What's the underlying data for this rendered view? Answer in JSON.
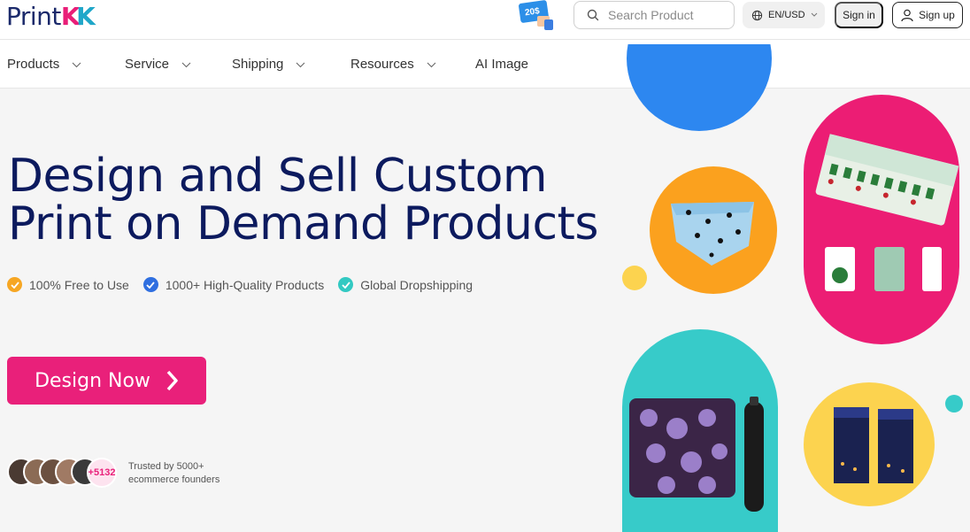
{
  "brand": {
    "logo_main": "Print",
    "logo_k1": "K",
    "logo_k2": "K"
  },
  "header": {
    "coupon_text": "20$",
    "search_placeholder": "Search Product",
    "language": "EN/USD",
    "signin_label": "Sign in",
    "signup_label": "Sign up"
  },
  "nav": {
    "items": [
      {
        "label": "Products"
      },
      {
        "label": "Service"
      },
      {
        "label": "Shipping"
      },
      {
        "label": "Resources"
      },
      {
        "label": "AI Image"
      }
    ]
  },
  "hero": {
    "title_line1": "Design and Sell Custom",
    "title_line2": "Print on Demand Products",
    "features": [
      {
        "text": "100% Free to Use",
        "color": "#f6a623"
      },
      {
        "text": "1000+ High-Quality Products",
        "color": "#2f6fe0"
      },
      {
        "text": "Global Dropshipping",
        "color": "#32c9c2"
      }
    ],
    "cta_label": "Design Now",
    "social_count": "+5132",
    "trusted_line1": "Trusted by 5000+",
    "trusted_line2": "ecommerce founders"
  },
  "colors": {
    "navy": "#0c1a5e",
    "pink": "#e9207a",
    "blue": "#2d87f0",
    "orange": "#fba11e",
    "teal": "#37cbc9",
    "yellow": "#fcd34f",
    "bg": "#f5f5f5"
  },
  "icons": [
    "search-icon",
    "globe-icon",
    "chevron-down-icon",
    "user-icon",
    "check-icon",
    "arrow-right-icon",
    "coupon-icon"
  ]
}
